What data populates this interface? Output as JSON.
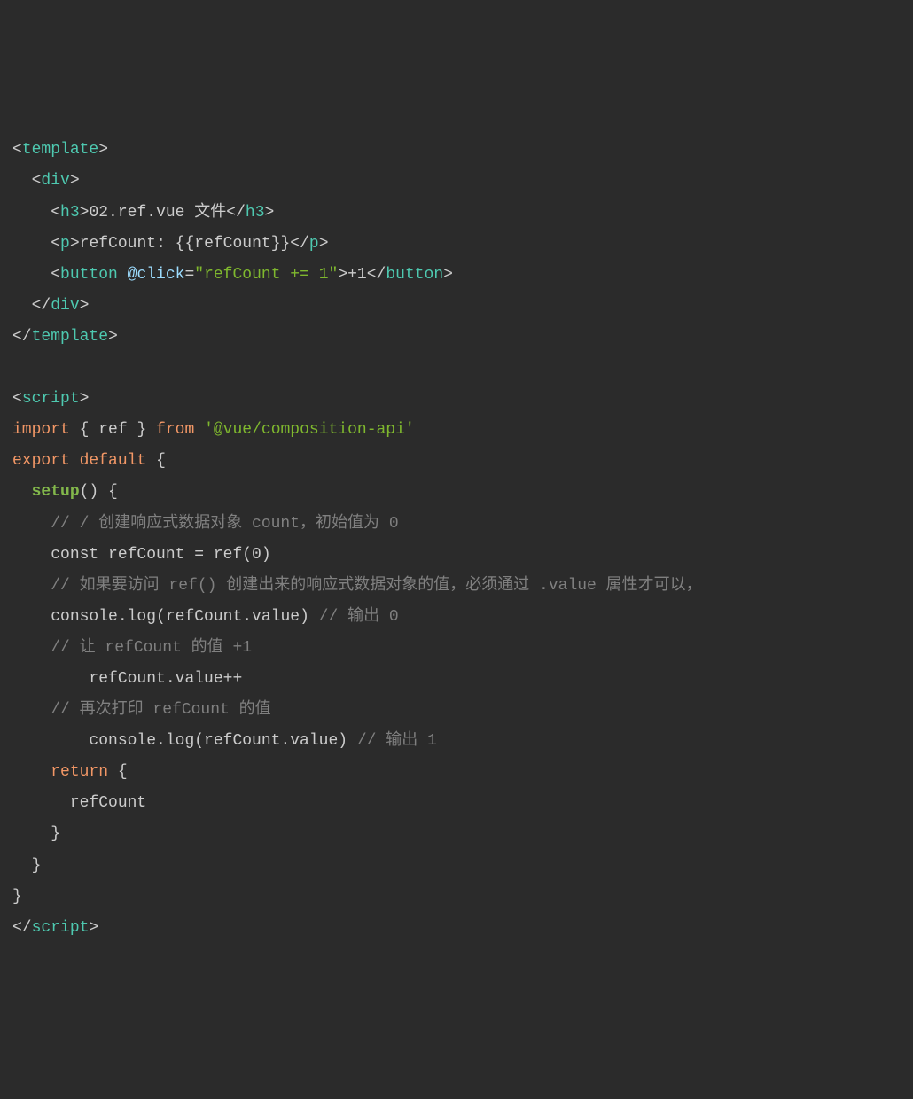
{
  "code": {
    "line01": {
      "p1": "<",
      "tag1": "template",
      "p2": ">"
    },
    "line02": {
      "indent": "  ",
      "p1": "<",
      "tag1": "div",
      "p2": ">"
    },
    "line03": {
      "indent": "    ",
      "p1": "<",
      "tag1": "h3",
      "p2": ">",
      "text": "02.ref.vue 文件",
      "p3": "</",
      "tag2": "h3",
      "p4": ">"
    },
    "line04": {
      "indent": "    ",
      "p1": "<",
      "tag1": "p",
      "p2": ">",
      "text": "refCount: {{refCount}}",
      "p3": "</",
      "tag2": "p",
      "p4": ">"
    },
    "line05": {
      "indent": "    ",
      "p1": "<",
      "tag1": "button",
      "sp": " ",
      "attr": "@click",
      "eq": "=",
      "str": "\"refCount += 1\"",
      "p2": ">",
      "text": "+1",
      "p3": "</",
      "tag2": "button",
      "p4": ">"
    },
    "line06": {
      "indent": "  ",
      "p1": "</",
      "tag1": "div",
      "p2": ">"
    },
    "line07": {
      "p1": "</",
      "tag1": "template",
      "p2": ">"
    },
    "line08": {
      "blank": ""
    },
    "line09": {
      "p1": "<",
      "tag1": "script",
      "p2": ">"
    },
    "line10": {
      "kw1": "import",
      "sp1": " ",
      "p1": "{ ",
      "id": "ref",
      "p2": " } ",
      "kw2": "from",
      "sp2": " ",
      "str": "'@vue/composition-api'"
    },
    "line11": {
      "kw1": "export",
      "sp": " ",
      "kw2": "default",
      "sp2": " ",
      "p1": "{"
    },
    "line12": {
      "indent": "  ",
      "func": "setup",
      "p1": "() {"
    },
    "line13": {
      "indent": "    ",
      "comment": "// / 创建响应式数据对象 count，初始值为 0"
    },
    "line14": {
      "indent": "    ",
      "text": "const refCount = ref(0)"
    },
    "line15": {
      "indent": "    ",
      "comment": "// 如果要访问 ref() 创建出来的响应式数据对象的值，必须通过 .value 属性才可以，"
    },
    "line16": {
      "indent": "    ",
      "text": "console.log(refCount.value) ",
      "comment": "// 输出 0"
    },
    "line17": {
      "indent": "    ",
      "comment": "// 让 refCount 的值 +1"
    },
    "line18": {
      "indent": "        ",
      "text": "refCount.value++"
    },
    "line19": {
      "indent": "    ",
      "comment": "// 再次打印 refCount 的值"
    },
    "line20": {
      "indent": "        ",
      "text": "console.log(refCount.value) ",
      "comment": "// 输出 1"
    },
    "line21": {
      "indent": "    ",
      "kw": "return",
      "sp": " ",
      "p1": "{"
    },
    "line22": {
      "indent": "      ",
      "text": "refCount"
    },
    "line23": {
      "indent": "    ",
      "p1": "}"
    },
    "line24": {
      "indent": "  ",
      "p1": "}"
    },
    "line25": {
      "p1": "}"
    },
    "line26": {
      "p1": "</",
      "tag1": "script",
      "p2": ">"
    }
  }
}
